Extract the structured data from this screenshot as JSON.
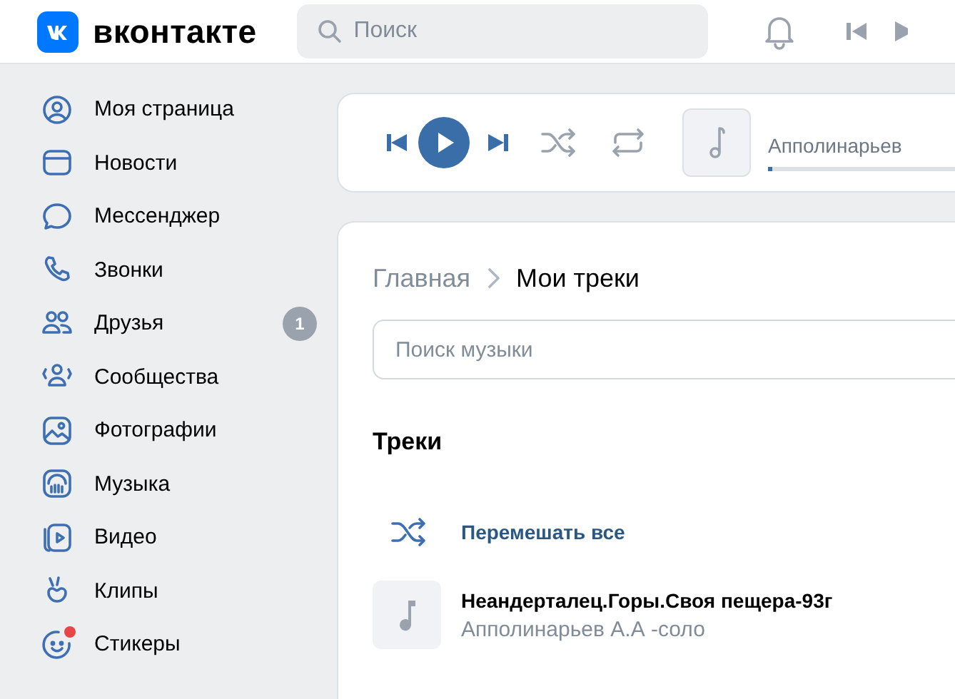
{
  "header": {
    "logo_text": "вконтакте",
    "search": {
      "placeholder": "Поиск"
    }
  },
  "sidebar": {
    "items": [
      {
        "label": "Моя страница"
      },
      {
        "label": "Новости"
      },
      {
        "label": "Мессенджер"
      },
      {
        "label": "Звонки"
      },
      {
        "label": "Друзья",
        "badge": "1"
      },
      {
        "label": "Сообщества"
      },
      {
        "label": "Фотографии"
      },
      {
        "label": "Музыка"
      },
      {
        "label": "Видео"
      },
      {
        "label": "Клипы"
      },
      {
        "label": "Стикеры",
        "notification_dot": true
      }
    ]
  },
  "player": {
    "artist": "Апполинарьев",
    "level": 0.01
  },
  "music": {
    "breadcrumb": [
      {
        "label": "Главная",
        "selected": false
      },
      {
        "label": "Мои треки",
        "selected": true
      }
    ],
    "search": {
      "placeholder": "Поиск музыки"
    },
    "section_title": "Треки",
    "shuffle_all": "Перемешать все",
    "tracks": [
      {
        "title": "Неандерталец.Горы.Своя пещера-93г",
        "artist": "Апполинарьев А.А -соло"
      }
    ]
  }
}
